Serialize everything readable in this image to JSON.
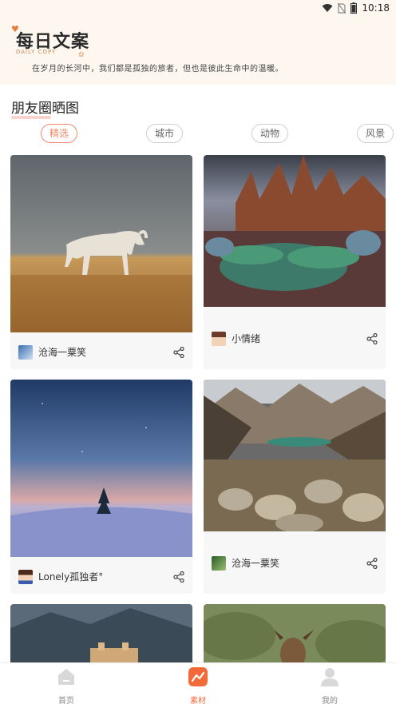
{
  "status_bar": {
    "time": "10:18"
  },
  "header": {
    "logo_text": "每日文案",
    "logo_sub": "DAILY COPY",
    "quote": "在岁月的长河中，我们都是孤独的旅者，但也是彼此生命中的温暖。"
  },
  "section_title": "朋友圈晒图",
  "tabs": [
    {
      "label": "精选",
      "active": true
    },
    {
      "label": "城市",
      "active": false
    },
    {
      "label": "动物",
      "active": false
    },
    {
      "label": "风景",
      "active": false
    }
  ],
  "cards": [
    {
      "author": "沧海一粟笑",
      "image": "white-horse-on-grassland"
    },
    {
      "author": "小情绪",
      "image": "desert-rocks-and-plants"
    },
    {
      "author": "Lonely孤独者°",
      "image": "lonely-tree-on-snow-hill"
    },
    {
      "author": "沧海一粟笑",
      "image": "mountain-valley-with-cactus"
    },
    {
      "author": "",
      "image": "castle-in-mountains"
    },
    {
      "author": "",
      "image": "deer-in-grass"
    }
  ],
  "bottom_nav": [
    {
      "label": "首页",
      "icon": "home-icon",
      "active": false
    },
    {
      "label": "素材",
      "icon": "material-icon",
      "active": true
    },
    {
      "label": "我的",
      "icon": "profile-icon",
      "active": false
    }
  ],
  "colors": {
    "accent": "#f26a3a",
    "tab_active": "#f08a6a",
    "header_bg": "#fdf7f0"
  }
}
